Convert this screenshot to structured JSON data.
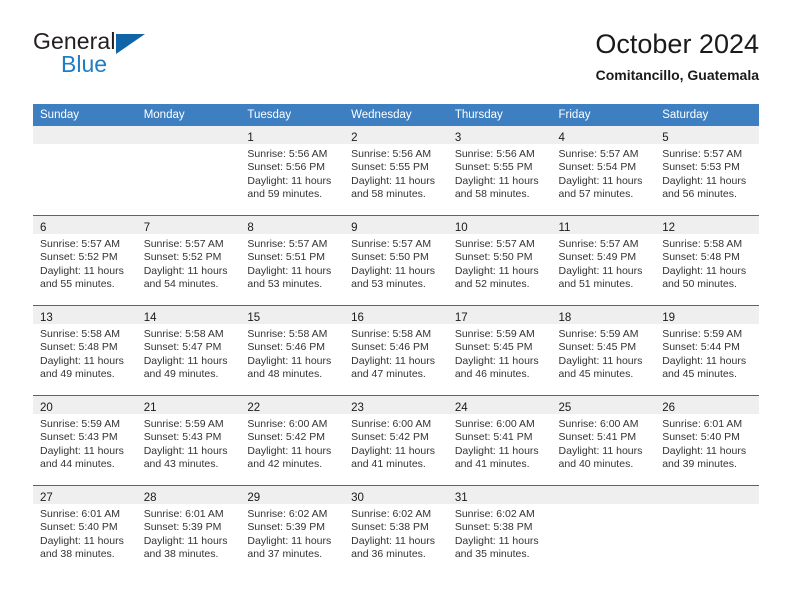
{
  "brand": {
    "name_part1": "General",
    "name_part2": "Blue",
    "triangle_color": "#1064a8",
    "blue_text_color": "#1f7dc4"
  },
  "header": {
    "month_title": "October 2024",
    "location": "Comitancillo, Guatemala"
  },
  "colors": {
    "header_blue": "#3d7fc1",
    "row_divider_blue": "#2f6fb0",
    "daynum_band_gray": "#efefef"
  },
  "weekdays": [
    "Sunday",
    "Monday",
    "Tuesday",
    "Wednesday",
    "Thursday",
    "Friday",
    "Saturday"
  ],
  "weeks": [
    [
      {
        "day": "",
        "sunrise": "",
        "sunset": "",
        "daylight": "",
        "empty": true
      },
      {
        "day": "",
        "sunrise": "",
        "sunset": "",
        "daylight": "",
        "empty": true
      },
      {
        "day": "1",
        "sunrise": "Sunrise: 5:56 AM",
        "sunset": "Sunset: 5:56 PM",
        "daylight": "Daylight: 11 hours and 59 minutes.",
        "empty": false
      },
      {
        "day": "2",
        "sunrise": "Sunrise: 5:56 AM",
        "sunset": "Sunset: 5:55 PM",
        "daylight": "Daylight: 11 hours and 58 minutes.",
        "empty": false
      },
      {
        "day": "3",
        "sunrise": "Sunrise: 5:56 AM",
        "sunset": "Sunset: 5:55 PM",
        "daylight": "Daylight: 11 hours and 58 minutes.",
        "empty": false
      },
      {
        "day": "4",
        "sunrise": "Sunrise: 5:57 AM",
        "sunset": "Sunset: 5:54 PM",
        "daylight": "Daylight: 11 hours and 57 minutes.",
        "empty": false
      },
      {
        "day": "5",
        "sunrise": "Sunrise: 5:57 AM",
        "sunset": "Sunset: 5:53 PM",
        "daylight": "Daylight: 11 hours and 56 minutes.",
        "empty": false
      }
    ],
    [
      {
        "day": "6",
        "sunrise": "Sunrise: 5:57 AM",
        "sunset": "Sunset: 5:52 PM",
        "daylight": "Daylight: 11 hours and 55 minutes.",
        "empty": false
      },
      {
        "day": "7",
        "sunrise": "Sunrise: 5:57 AM",
        "sunset": "Sunset: 5:52 PM",
        "daylight": "Daylight: 11 hours and 54 minutes.",
        "empty": false
      },
      {
        "day": "8",
        "sunrise": "Sunrise: 5:57 AM",
        "sunset": "Sunset: 5:51 PM",
        "daylight": "Daylight: 11 hours and 53 minutes.",
        "empty": false
      },
      {
        "day": "9",
        "sunrise": "Sunrise: 5:57 AM",
        "sunset": "Sunset: 5:50 PM",
        "daylight": "Daylight: 11 hours and 53 minutes.",
        "empty": false
      },
      {
        "day": "10",
        "sunrise": "Sunrise: 5:57 AM",
        "sunset": "Sunset: 5:50 PM",
        "daylight": "Daylight: 11 hours and 52 minutes.",
        "empty": false
      },
      {
        "day": "11",
        "sunrise": "Sunrise: 5:57 AM",
        "sunset": "Sunset: 5:49 PM",
        "daylight": "Daylight: 11 hours and 51 minutes.",
        "empty": false
      },
      {
        "day": "12",
        "sunrise": "Sunrise: 5:58 AM",
        "sunset": "Sunset: 5:48 PM",
        "daylight": "Daylight: 11 hours and 50 minutes.",
        "empty": false
      }
    ],
    [
      {
        "day": "13",
        "sunrise": "Sunrise: 5:58 AM",
        "sunset": "Sunset: 5:48 PM",
        "daylight": "Daylight: 11 hours and 49 minutes.",
        "empty": false
      },
      {
        "day": "14",
        "sunrise": "Sunrise: 5:58 AM",
        "sunset": "Sunset: 5:47 PM",
        "daylight": "Daylight: 11 hours and 49 minutes.",
        "empty": false
      },
      {
        "day": "15",
        "sunrise": "Sunrise: 5:58 AM",
        "sunset": "Sunset: 5:46 PM",
        "daylight": "Daylight: 11 hours and 48 minutes.",
        "empty": false
      },
      {
        "day": "16",
        "sunrise": "Sunrise: 5:58 AM",
        "sunset": "Sunset: 5:46 PM",
        "daylight": "Daylight: 11 hours and 47 minutes.",
        "empty": false
      },
      {
        "day": "17",
        "sunrise": "Sunrise: 5:59 AM",
        "sunset": "Sunset: 5:45 PM",
        "daylight": "Daylight: 11 hours and 46 minutes.",
        "empty": false
      },
      {
        "day": "18",
        "sunrise": "Sunrise: 5:59 AM",
        "sunset": "Sunset: 5:45 PM",
        "daylight": "Daylight: 11 hours and 45 minutes.",
        "empty": false
      },
      {
        "day": "19",
        "sunrise": "Sunrise: 5:59 AM",
        "sunset": "Sunset: 5:44 PM",
        "daylight": "Daylight: 11 hours and 45 minutes.",
        "empty": false
      }
    ],
    [
      {
        "day": "20",
        "sunrise": "Sunrise: 5:59 AM",
        "sunset": "Sunset: 5:43 PM",
        "daylight": "Daylight: 11 hours and 44 minutes.",
        "empty": false
      },
      {
        "day": "21",
        "sunrise": "Sunrise: 5:59 AM",
        "sunset": "Sunset: 5:43 PM",
        "daylight": "Daylight: 11 hours and 43 minutes.",
        "empty": false
      },
      {
        "day": "22",
        "sunrise": "Sunrise: 6:00 AM",
        "sunset": "Sunset: 5:42 PM",
        "daylight": "Daylight: 11 hours and 42 minutes.",
        "empty": false
      },
      {
        "day": "23",
        "sunrise": "Sunrise: 6:00 AM",
        "sunset": "Sunset: 5:42 PM",
        "daylight": "Daylight: 11 hours and 41 minutes.",
        "empty": false
      },
      {
        "day": "24",
        "sunrise": "Sunrise: 6:00 AM",
        "sunset": "Sunset: 5:41 PM",
        "daylight": "Daylight: 11 hours and 41 minutes.",
        "empty": false
      },
      {
        "day": "25",
        "sunrise": "Sunrise: 6:00 AM",
        "sunset": "Sunset: 5:41 PM",
        "daylight": "Daylight: 11 hours and 40 minutes.",
        "empty": false
      },
      {
        "day": "26",
        "sunrise": "Sunrise: 6:01 AM",
        "sunset": "Sunset: 5:40 PM",
        "daylight": "Daylight: 11 hours and 39 minutes.",
        "empty": false
      }
    ],
    [
      {
        "day": "27",
        "sunrise": "Sunrise: 6:01 AM",
        "sunset": "Sunset: 5:40 PM",
        "daylight": "Daylight: 11 hours and 38 minutes.",
        "empty": false
      },
      {
        "day": "28",
        "sunrise": "Sunrise: 6:01 AM",
        "sunset": "Sunset: 5:39 PM",
        "daylight": "Daylight: 11 hours and 38 minutes.",
        "empty": false
      },
      {
        "day": "29",
        "sunrise": "Sunrise: 6:02 AM",
        "sunset": "Sunset: 5:39 PM",
        "daylight": "Daylight: 11 hours and 37 minutes.",
        "empty": false
      },
      {
        "day": "30",
        "sunrise": "Sunrise: 6:02 AM",
        "sunset": "Sunset: 5:38 PM",
        "daylight": "Daylight: 11 hours and 36 minutes.",
        "empty": false
      },
      {
        "day": "31",
        "sunrise": "Sunrise: 6:02 AM",
        "sunset": "Sunset: 5:38 PM",
        "daylight": "Daylight: 11 hours and 35 minutes.",
        "empty": false
      },
      {
        "day": "",
        "sunrise": "",
        "sunset": "",
        "daylight": "",
        "empty": true
      },
      {
        "day": "",
        "sunrise": "",
        "sunset": "",
        "daylight": "",
        "empty": true
      }
    ]
  ]
}
